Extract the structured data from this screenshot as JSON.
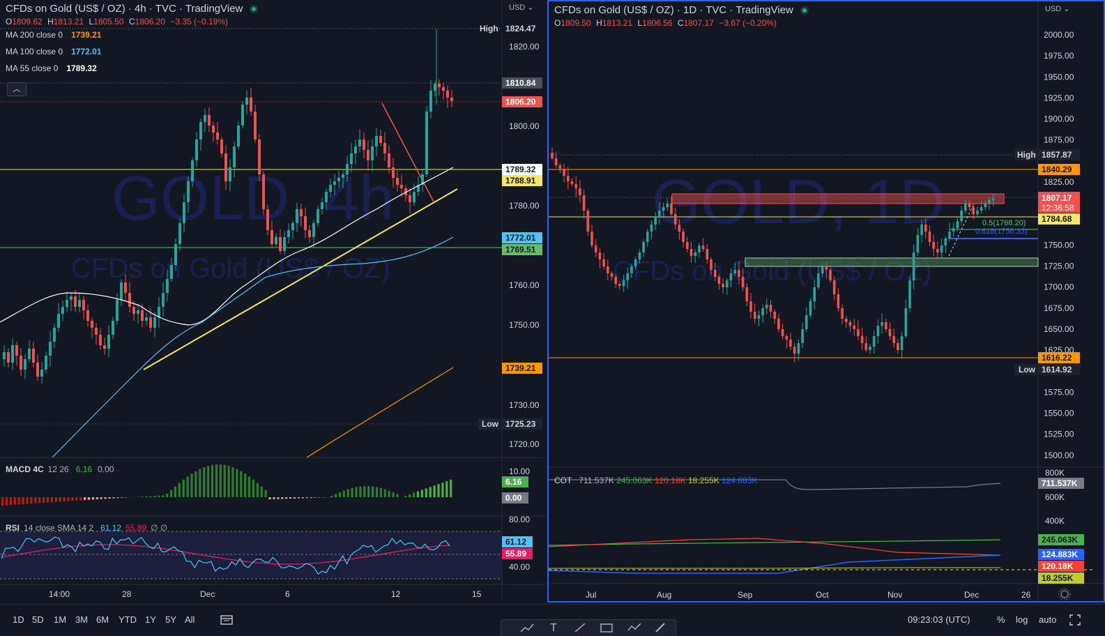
{
  "left": {
    "title": "CFDs on Gold (US$ / OZ) · 4h · TVC · TradingView",
    "watermark_main": "GOLD, 4h",
    "watermark_sub": "CFDs on Gold (US$ / OZ)",
    "ohlc": {
      "o_label": "O",
      "o": "1809.62",
      "h_label": "H",
      "h": "1813.21",
      "l_label": "L",
      "l": "1805.50",
      "c_label": "C",
      "c": "1806.20",
      "chg": "−3.35 (−0.19%)"
    },
    "ma": [
      {
        "label": "MA 200 close 0",
        "value": "1739.21",
        "color": "#ff9800"
      },
      {
        "label": "MA 100 close 0",
        "value": "1772.01",
        "color": "#4fc3f7"
      },
      {
        "label": "MA 55 close 0",
        "value": "1789.32",
        "color": "#ffffff"
      }
    ],
    "collapse_icon": "chevron-up-icon",
    "currency": "USD",
    "axis_ticks": [
      "1820.00",
      "1800.00",
      "1780.00",
      "1760.00",
      "1750.00",
      "1730.00",
      "1720.00"
    ],
    "price_tags": {
      "high_label": "High",
      "high": "1824.47",
      "tag1": "1810.84",
      "last": "1806.20",
      "ma55": "1789.32",
      "yellow": "1788.91",
      "ma100": "1772.01",
      "green": "1769.51",
      "ma200": "1739.21",
      "low_label": "Low",
      "low": "1725.23"
    },
    "macd": {
      "name": "MACD 4C",
      "params": "12 26",
      "v1": "6.16",
      "v2": "0.00",
      "axis": "10.00",
      "tag1": "6.16",
      "tag2": "0.00"
    },
    "rsi": {
      "name": "RSI",
      "params": "14 close SMA 14 2",
      "v1": "61.12",
      "v2": "55.89",
      "v3": "∅ ∅",
      "axis_top": "80.00",
      "axis_bot": "40.00",
      "tag1": "61.12",
      "tag2": "55.89"
    },
    "x_labels": [
      "14:00",
      "28",
      "Dec",
      "6",
      "12",
      "15"
    ]
  },
  "right": {
    "title": "CFDs on Gold (US$ / OZ) · 1D · TVC · TradingView",
    "watermark_main": "GOLD, 1D",
    "watermark_sub": "CFDs on Gold (US$ / OZ)",
    "ohlc": {
      "o_label": "O",
      "o": "1809.50",
      "h_label": "H",
      "h": "1813.21",
      "l_label": "L",
      "l": "1806.56",
      "c_label": "C",
      "c": "1807.17",
      "chg": "−3.67 (−0.20%)"
    },
    "currency": "USD",
    "axis_ticks": [
      "2000.00",
      "1975.00",
      "1950.00",
      "1925.00",
      "1900.00",
      "1875.00",
      "1825.00",
      "1750.00",
      "1725.00",
      "1700.00",
      "1675.00",
      "1650.00",
      "1625.00",
      "1575.00",
      "1550.00",
      "1525.00",
      "1500.00"
    ],
    "price_tags": {
      "high_label": "High",
      "high": "1857.87",
      "orange": "1840.29",
      "last": "1807.17",
      "countdown": "12:36:58",
      "yellow": "1784.68",
      "fib1": "0.5(1768.20)",
      "fib2": "0.618(1756.33)",
      "bottom": "1616.22",
      "low_label": "Low",
      "low": "1614.92"
    },
    "cot": {
      "name": "COT",
      "values": [
        {
          "v": "711.537K",
          "color": "#b2b5be"
        },
        {
          "v": "245.063K",
          "color": "#4caf50"
        },
        {
          "v": "120.18K",
          "color": "#f44336"
        },
        {
          "v": "18.255K",
          "color": "#c0ca33"
        },
        {
          "v": "124.883K",
          "color": "#2962ff"
        }
      ],
      "axis": [
        "800K",
        "600K",
        "400K"
      ],
      "tags": [
        "711.537K",
        "245.063K",
        "124.883K",
        "120.18K",
        "18.255K"
      ]
    },
    "x_labels": [
      "Jul",
      "Aug",
      "Sep",
      "Oct",
      "Nov",
      "Dec",
      "26"
    ],
    "settings_icon": "gear-icon"
  },
  "bottom": {
    "ranges": [
      "1D",
      "5D",
      "1M",
      "3M",
      "6M",
      "YTD",
      "1Y",
      "5Y",
      "All"
    ],
    "compare_icon": "calendar-range-icon",
    "time": "09:23:03 (UTC)",
    "percent": "%",
    "log": "log",
    "auto": "auto",
    "fullscreen_icon": "fullscreen-icon",
    "tools": [
      "trend-icon",
      "text-icon",
      "line-icon",
      "rectangle-icon",
      "path-icon",
      "brush-icon"
    ]
  }
}
